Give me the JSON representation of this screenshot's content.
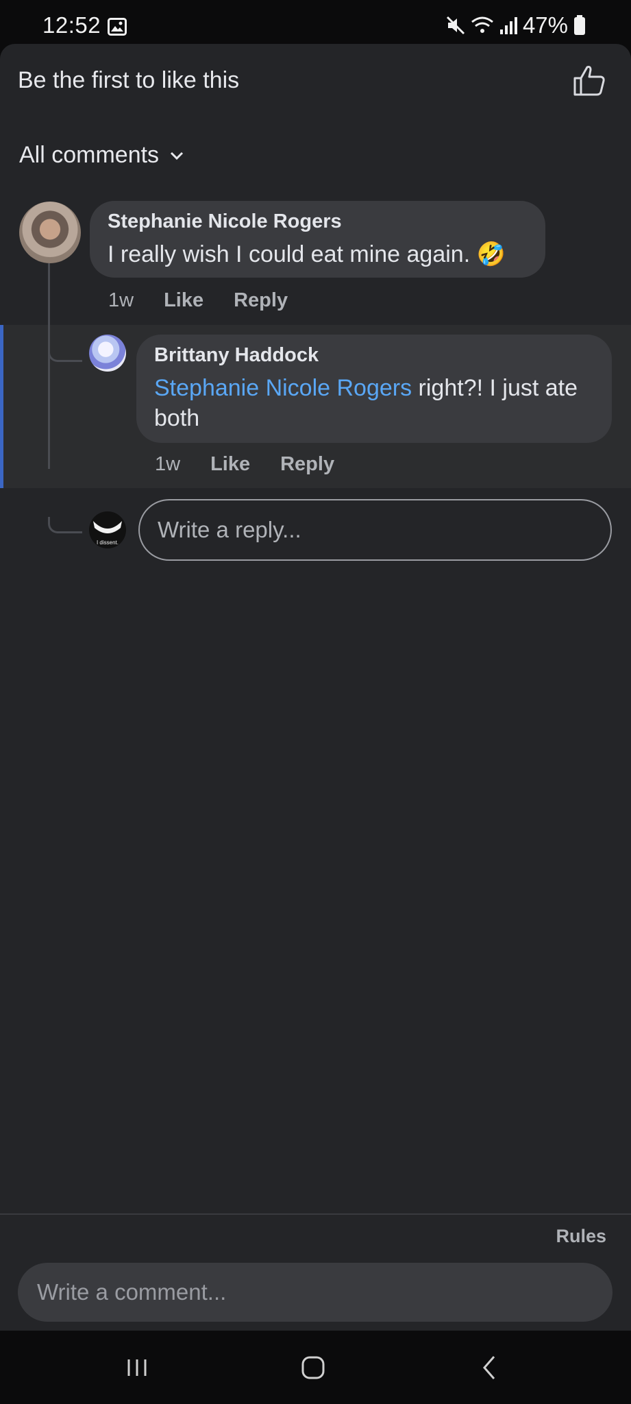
{
  "status_bar": {
    "time": "12:52",
    "battery": "47%"
  },
  "header": {
    "likes_text": "Be the first to like this"
  },
  "filter": {
    "label": "All comments"
  },
  "comments": [
    {
      "author": "Stephanie Nicole Rogers",
      "text": "I really wish I could eat mine again.",
      "emoji": "🤣",
      "time": "1w",
      "like_label": "Like",
      "reply_label": "Reply"
    }
  ],
  "replies": [
    {
      "author": "Brittany Haddock",
      "mention": "Stephanie Nicole Rogers",
      "text": " right?! I just ate both",
      "time": "1w",
      "like_label": "Like",
      "reply_label": "Reply"
    }
  ],
  "reply_box": {
    "placeholder": "Write a reply...",
    "avatar_caption": "I dissent."
  },
  "footer": {
    "rules_label": "Rules",
    "comment_placeholder": "Write a comment..."
  },
  "colors": {
    "background": "#242528",
    "bubble": "#3a3b3f",
    "mention": "#5aa7f5",
    "highlight_bar": "#3b66c4"
  }
}
